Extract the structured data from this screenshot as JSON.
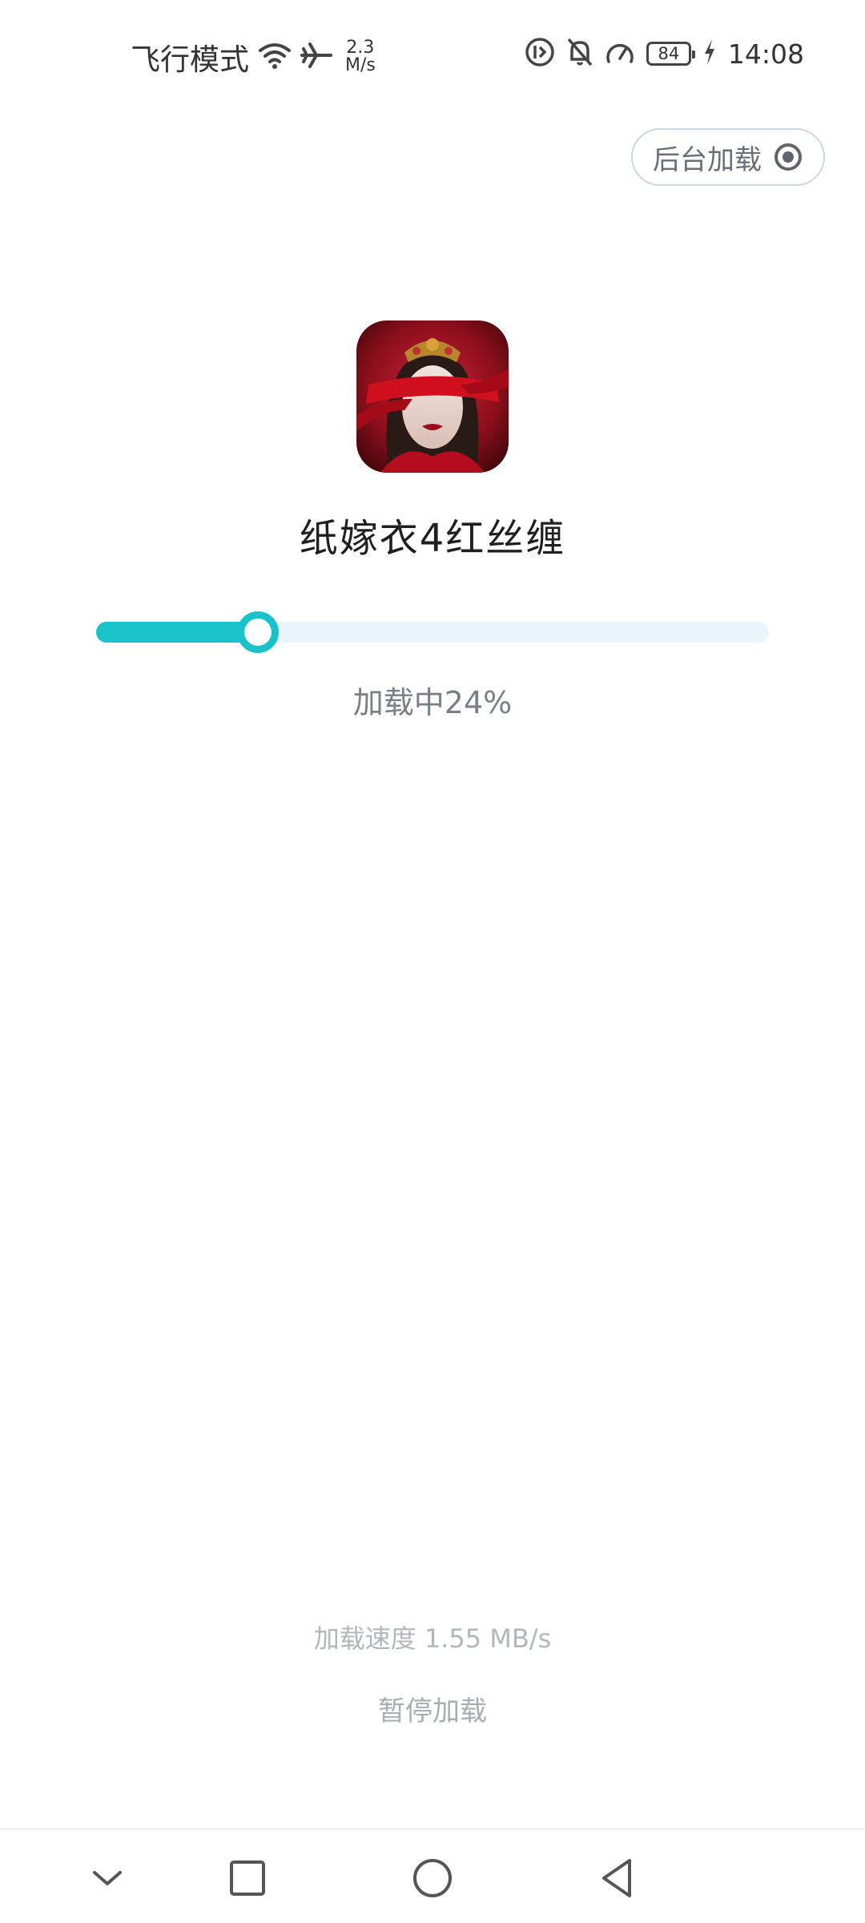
{
  "status_bar": {
    "mode_text": "飞行模式",
    "speed_value": "2.3",
    "speed_unit": "M/s",
    "battery_level": "84",
    "time": "14:08"
  },
  "bg_load_button": {
    "label": "后台加载"
  },
  "app": {
    "name": "纸嫁衣4红丝缠",
    "icon": "game-icon-red-veiled-bride"
  },
  "progress": {
    "percent": 24,
    "label": "加载中24%"
  },
  "load_speed": {
    "text": "加载速度 1.55 MB/s"
  },
  "pause_button": {
    "label": "暂停加载"
  },
  "nav": {
    "items": [
      "collapse-icon",
      "recents-icon",
      "home-icon",
      "back-icon"
    ]
  },
  "colors": {
    "accent": "#17c2c9",
    "track": "#eaf4fb",
    "muted_text": "#b3b7bb"
  }
}
